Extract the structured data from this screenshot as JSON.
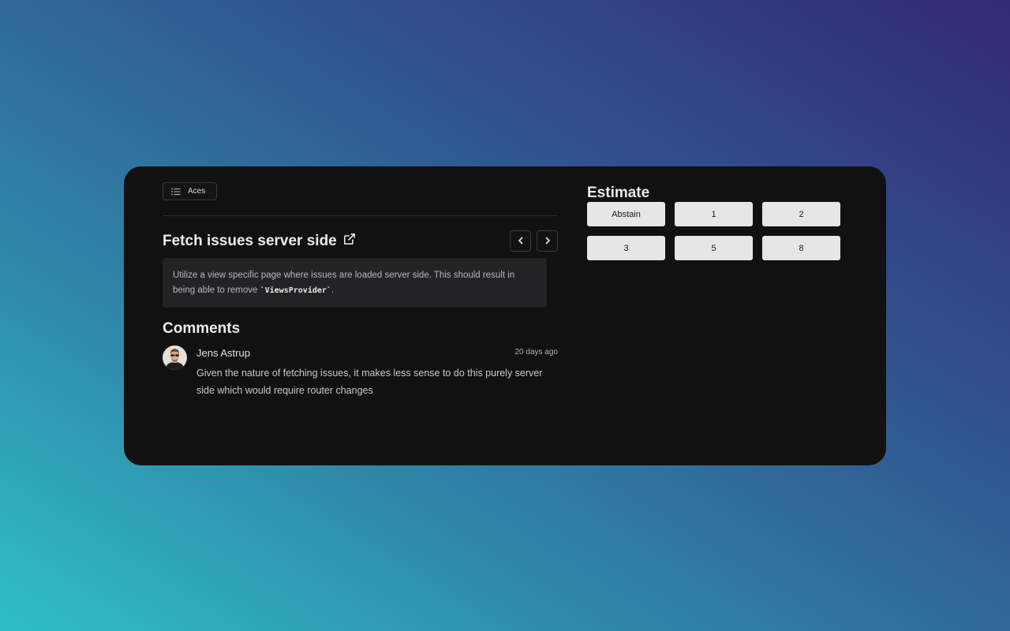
{
  "team": {
    "label": "Aces",
    "icon": "list-icon"
  },
  "issue": {
    "title": "Fetch issues server side",
    "title_icon": "external-link-icon",
    "description_prefix": "Utilize a view specific page where issues are loaded server side. This should result in being able to remove ",
    "description_code": "`ViewsProvider`",
    "description_suffix": ".",
    "prev_icon": "chevron-left-icon",
    "next_icon": "chevron-right-icon"
  },
  "comments": {
    "heading": "Comments",
    "items": [
      {
        "author": "Jens Astrup",
        "time": "20 days ago",
        "body": "Given the nature of fetching issues, it makes less sense to do this purely server side which would require router changes"
      }
    ]
  },
  "estimate": {
    "heading": "Estimate",
    "options": [
      "Abstain",
      "1",
      "2",
      "3",
      "5",
      "8"
    ]
  },
  "colors": {
    "card_background": "#111111",
    "button_background": "#e6e6e6",
    "description_background": "#232326"
  }
}
